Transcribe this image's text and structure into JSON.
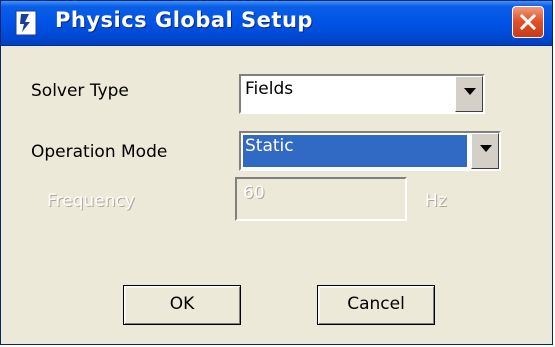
{
  "window": {
    "title": "Physics Global Setup",
    "close_icon": "close-icon",
    "app_icon": "application-icon"
  },
  "form": {
    "solver_type": {
      "label": "Solver Type",
      "value": "Fields"
    },
    "operation_mode": {
      "label": "Operation Mode",
      "value": "Static"
    },
    "frequency": {
      "label": "Frequency",
      "value": "60",
      "unit": "Hz"
    }
  },
  "buttons": {
    "ok": "OK",
    "cancel": "Cancel"
  },
  "colors": {
    "titlebar": "#0053e6",
    "selection": "#316ac5",
    "face": "#ece9d8",
    "close": "#e2532b"
  }
}
